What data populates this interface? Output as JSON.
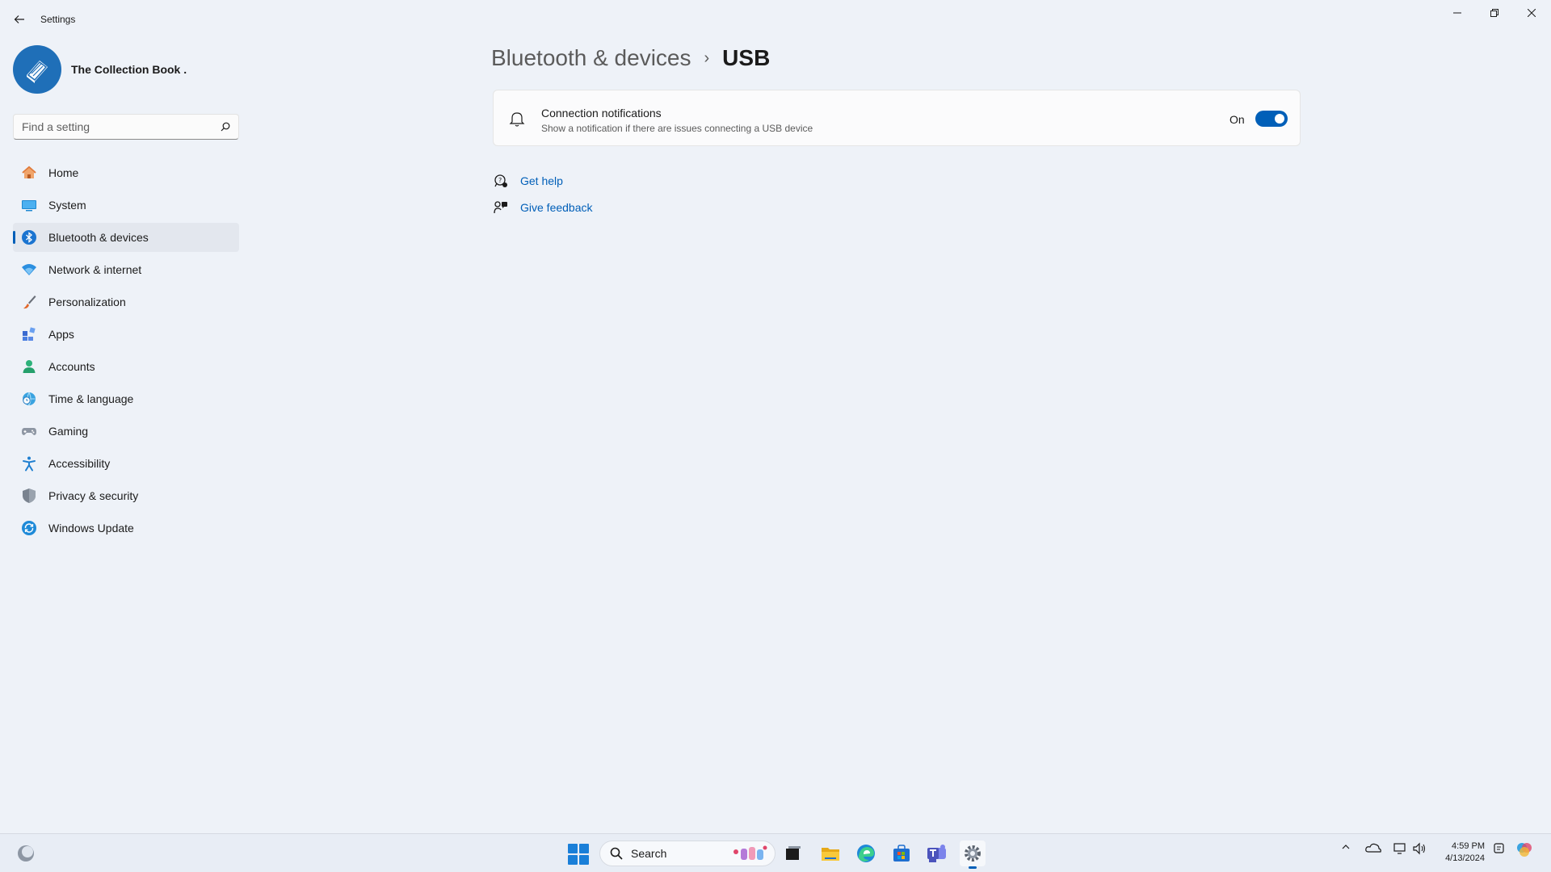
{
  "window": {
    "title": "Settings",
    "back_icon": "back-arrow-icon",
    "controls": [
      "minimize-icon",
      "restore-icon",
      "close-icon"
    ]
  },
  "profile": {
    "name": "The Collection Book ."
  },
  "search": {
    "placeholder": "Find a setting"
  },
  "sidebar": {
    "items": [
      {
        "label": "Home",
        "icon": "home-icon"
      },
      {
        "label": "System",
        "icon": "system-icon"
      },
      {
        "label": "Bluetooth & devices",
        "icon": "bluetooth-icon",
        "active": true
      },
      {
        "label": "Network & internet",
        "icon": "wifi-icon"
      },
      {
        "label": "Personalization",
        "icon": "brush-icon"
      },
      {
        "label": "Apps",
        "icon": "apps-icon"
      },
      {
        "label": "Accounts",
        "icon": "person-icon"
      },
      {
        "label": "Time & language",
        "icon": "globe-clock-icon"
      },
      {
        "label": "Gaming",
        "icon": "controller-icon"
      },
      {
        "label": "Accessibility",
        "icon": "accessibility-icon"
      },
      {
        "label": "Privacy & security",
        "icon": "shield-icon"
      },
      {
        "label": "Windows Update",
        "icon": "update-icon"
      }
    ]
  },
  "breadcrumb": {
    "parent": "Bluetooth & devices",
    "separator": "›",
    "current": "USB"
  },
  "setting": {
    "title": "Connection notifications",
    "description": "Show a notification if there are issues connecting a USB device",
    "toggle_label": "On",
    "toggle_on": true
  },
  "links": {
    "get_help": "Get help",
    "give_feedback": "Give feedback"
  },
  "taskbar": {
    "search_label": "Search",
    "clock_time": "4:59 PM",
    "clock_date": "4/13/2024"
  },
  "colors": {
    "accent": "#005fb8",
    "background": "#eef2f8"
  }
}
